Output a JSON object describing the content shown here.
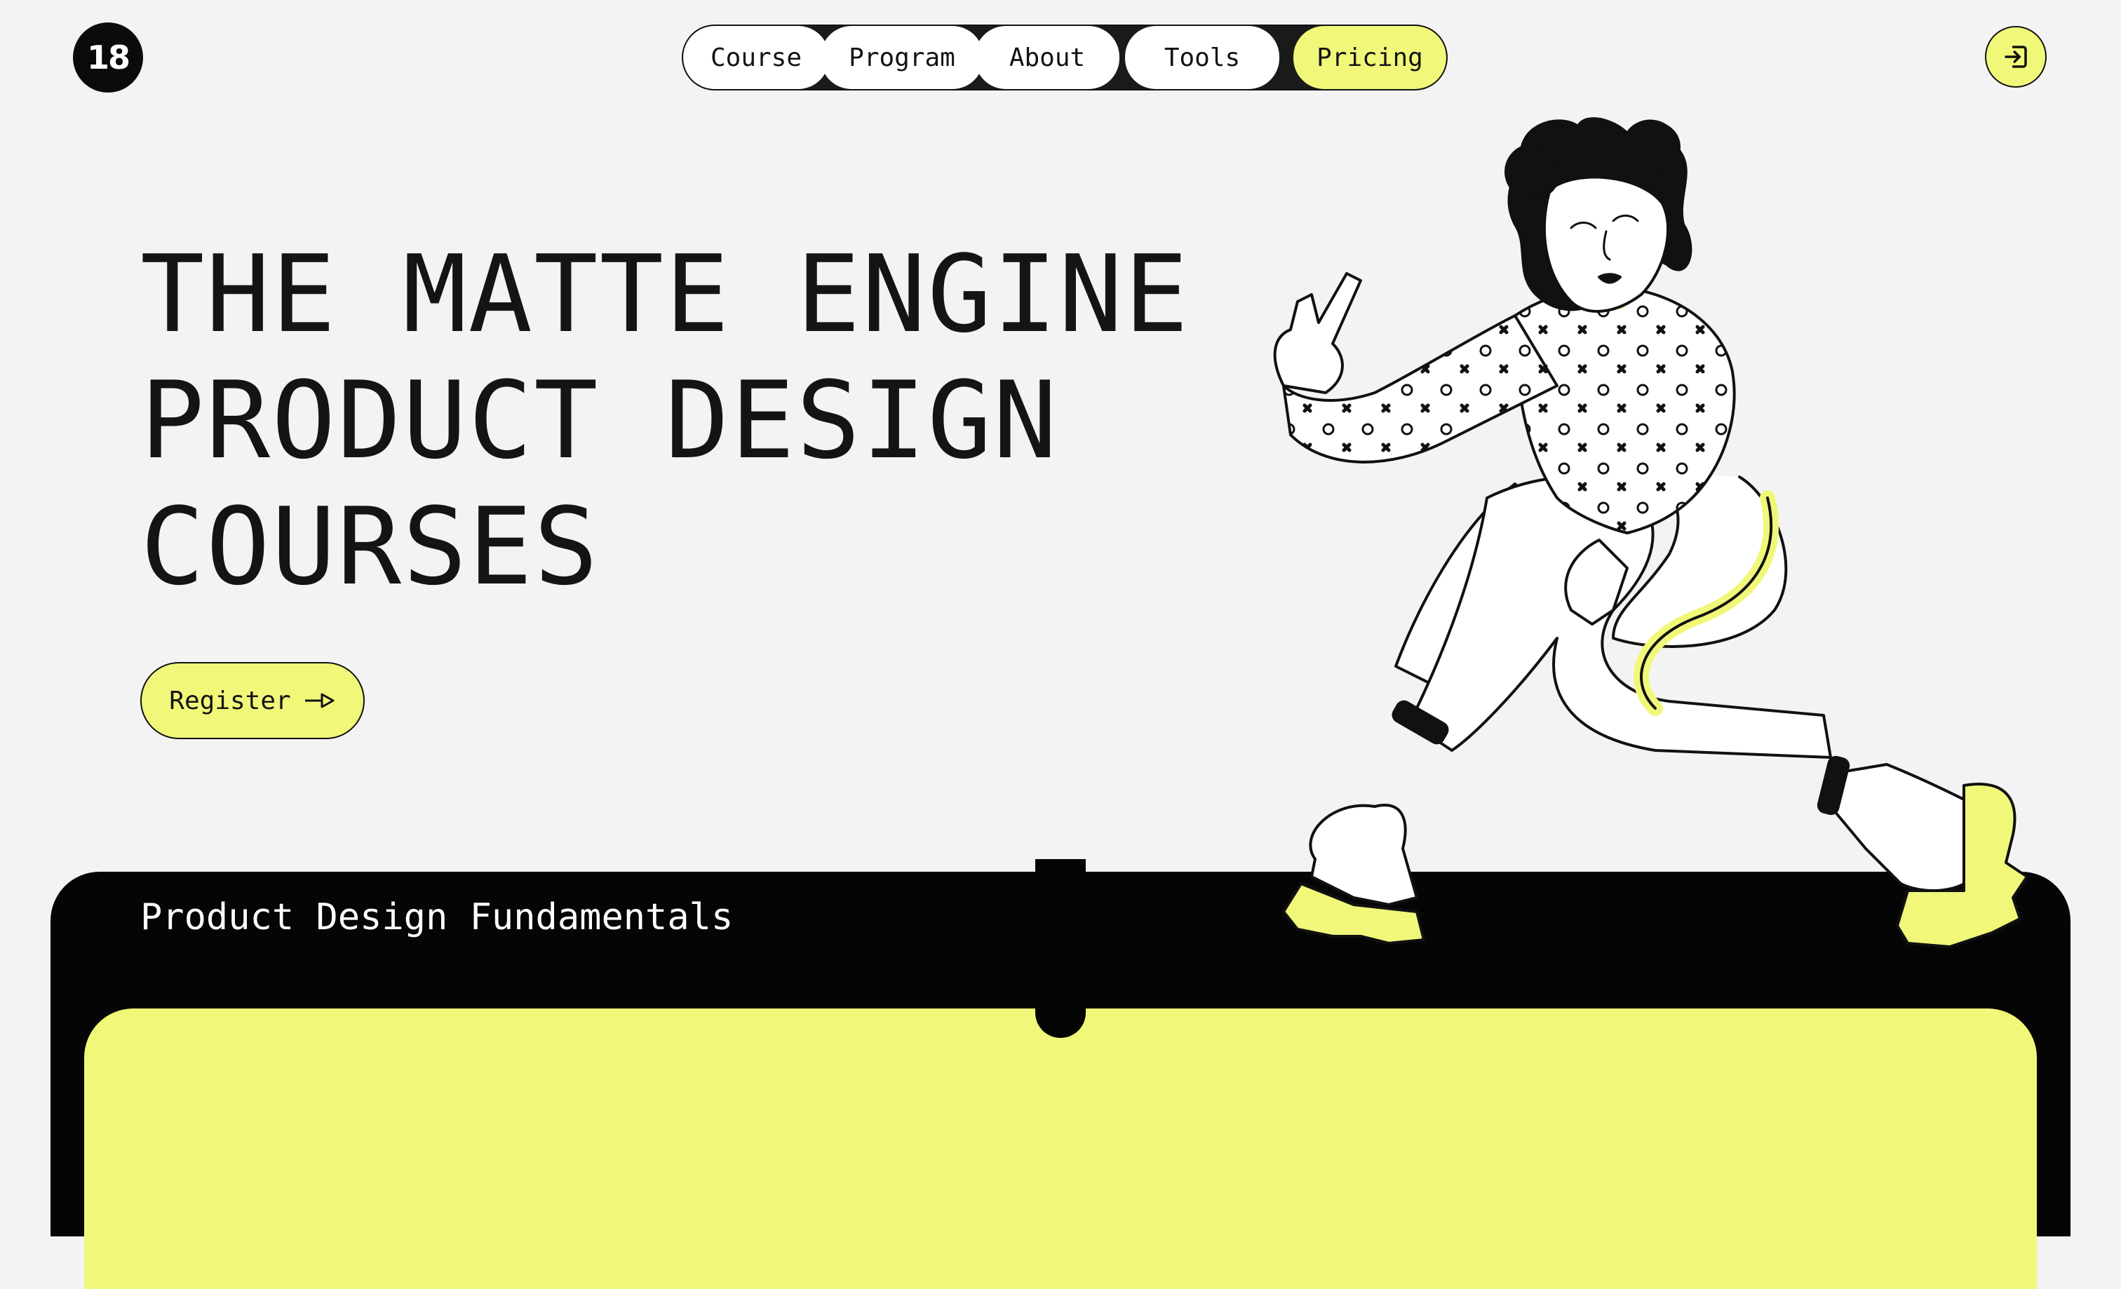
{
  "brand": {
    "logo_text": "18"
  },
  "nav": {
    "items": [
      {
        "label": "Course"
      },
      {
        "label": "Program"
      },
      {
        "label": "About"
      },
      {
        "label": "Tools"
      },
      {
        "label": "Pricing",
        "active": true
      }
    ]
  },
  "header": {
    "login_icon": "login-icon"
  },
  "hero": {
    "title_lines": [
      "THE MATTE ENGINE",
      "PRODUCT DESIGN",
      "COURSES"
    ],
    "register_label": "Register",
    "register_icon": "arrow-right-icon"
  },
  "section": {
    "title": "Product Design Fundamentals"
  },
  "colors": {
    "accent": "#f1f879",
    "dark": "#050505",
    "background": "#f3f3f3",
    "text": "#141414"
  }
}
